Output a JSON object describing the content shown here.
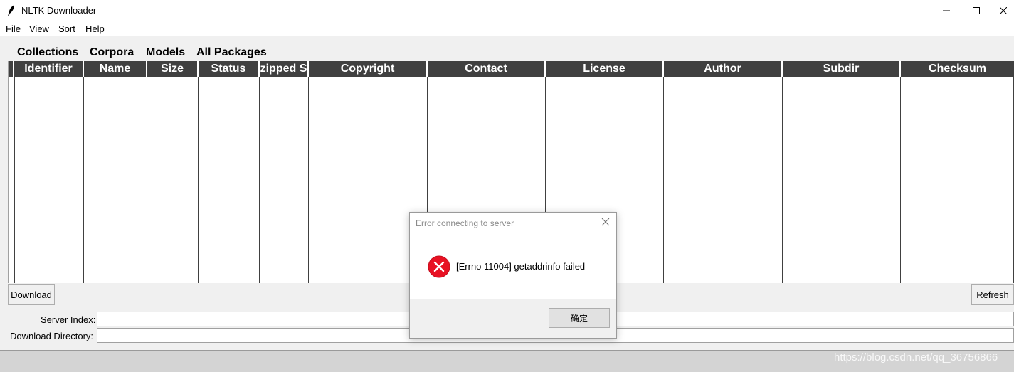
{
  "window": {
    "title": "NLTK Downloader"
  },
  "menu": [
    "File",
    "View",
    "Sort",
    "Help"
  ],
  "tabs": [
    "Collections",
    "Corpora",
    "Models",
    "All Packages"
  ],
  "table": {
    "columns": [
      "Identifier",
      "Name",
      "Size",
      "Status",
      "zipped S",
      "Copyright",
      "Contact",
      "License",
      "Author",
      "Subdir",
      "Checksum"
    ],
    "rows": []
  },
  "buttons": {
    "download": "Download",
    "refresh": "Refresh"
  },
  "fields": {
    "server_index_label": "Server Index:",
    "server_index_value": "",
    "download_dir_label": "Download Directory:",
    "download_dir_value": ""
  },
  "dialog": {
    "title": "Error connecting to server",
    "message": "[Errno 11004] getaddrinfo failed",
    "ok_label": "确定"
  },
  "watermark": "https://blog.csdn.net/qq_36756866"
}
